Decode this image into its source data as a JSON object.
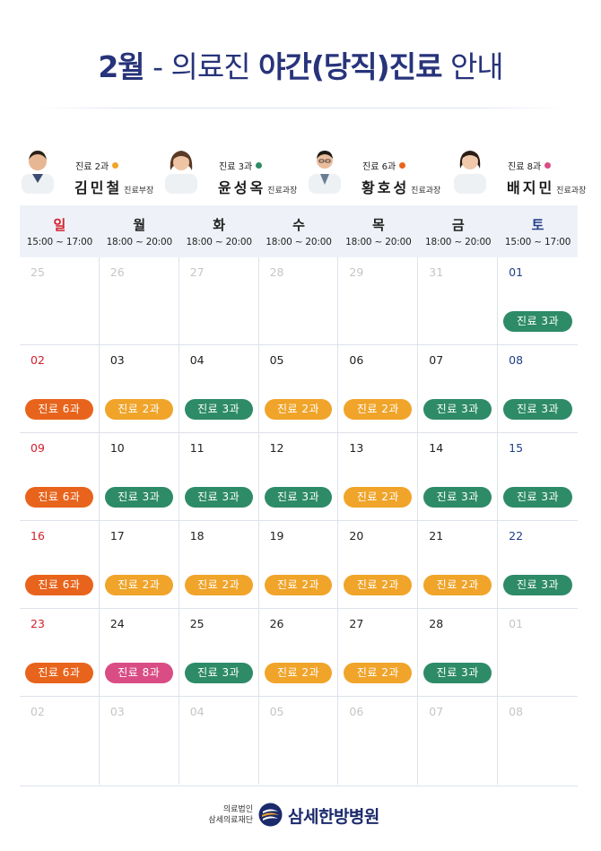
{
  "title": {
    "month": "2월",
    "dash": " - ",
    "prefix": "의료진 ",
    "highlight": "야간(당직)진료",
    "suffix": " 안내"
  },
  "doctors": [
    {
      "dept": "진료 2과",
      "name": "김민철",
      "role": "진료부장",
      "color": "#f0a42a"
    },
    {
      "dept": "진료 3과",
      "name": "윤성옥",
      "role": "진료과장",
      "color": "#2e8b68"
    },
    {
      "dept": "진료 6과",
      "name": "황호성",
      "role": "진료과장",
      "color": "#e8641c"
    },
    {
      "dept": "진료 8과",
      "name": "배지민",
      "role": "진료과장",
      "color": "#d94d84"
    }
  ],
  "weekdays": [
    {
      "day": "일",
      "time": "15:00 ~ 17:00"
    },
    {
      "day": "월",
      "time": "18:00 ~ 20:00"
    },
    {
      "day": "화",
      "time": "18:00 ~ 20:00"
    },
    {
      "day": "수",
      "time": "18:00 ~ 20:00"
    },
    {
      "day": "목",
      "time": "18:00 ~ 20:00"
    },
    {
      "day": "금",
      "time": "18:00 ~ 20:00"
    },
    {
      "day": "토",
      "time": "15:00 ~ 17:00"
    }
  ],
  "dept_colors": {
    "진료 2과": "#f0a42a",
    "진료 3과": "#2e8b68",
    "진료 6과": "#e8641c",
    "진료 8과": "#d94d84"
  },
  "weeks": [
    [
      {
        "date": "25",
        "dim": true
      },
      {
        "date": "26",
        "dim": true
      },
      {
        "date": "27",
        "dim": true
      },
      {
        "date": "28",
        "dim": true
      },
      {
        "date": "29",
        "dim": true
      },
      {
        "date": "31",
        "dim": true
      },
      {
        "date": "01",
        "duty": "진료 3과"
      }
    ],
    [
      {
        "date": "02",
        "duty": "진료 6과"
      },
      {
        "date": "03",
        "duty": "진료 2과"
      },
      {
        "date": "04",
        "duty": "진료 3과"
      },
      {
        "date": "05",
        "duty": "진료 2과"
      },
      {
        "date": "06",
        "duty": "진료 2과"
      },
      {
        "date": "07",
        "duty": "진료 3과"
      },
      {
        "date": "08",
        "duty": "진료 3과"
      }
    ],
    [
      {
        "date": "09",
        "duty": "진료 6과"
      },
      {
        "date": "10",
        "duty": "진료 3과"
      },
      {
        "date": "11",
        "duty": "진료 3과"
      },
      {
        "date": "12",
        "duty": "진료 3과"
      },
      {
        "date": "13",
        "duty": "진료 2과"
      },
      {
        "date": "14",
        "duty": "진료 3과"
      },
      {
        "date": "15",
        "duty": "진료 3과"
      }
    ],
    [
      {
        "date": "16",
        "duty": "진료 6과"
      },
      {
        "date": "17",
        "duty": "진료 2과"
      },
      {
        "date": "18",
        "duty": "진료 2과"
      },
      {
        "date": "19",
        "duty": "진료 2과"
      },
      {
        "date": "20",
        "duty": "진료 2과"
      },
      {
        "date": "21",
        "duty": "진료 2과"
      },
      {
        "date": "22",
        "duty": "진료 3과"
      }
    ],
    [
      {
        "date": "23",
        "duty": "진료 6과"
      },
      {
        "date": "24",
        "duty": "진료 8과"
      },
      {
        "date": "25",
        "duty": "진료 3과"
      },
      {
        "date": "26",
        "duty": "진료 2과"
      },
      {
        "date": "27",
        "duty": "진료 2과"
      },
      {
        "date": "28",
        "duty": "진료 3과"
      },
      {
        "date": "01",
        "dim": true
      }
    ],
    [
      {
        "date": "02",
        "dim": true
      },
      {
        "date": "03",
        "dim": true
      },
      {
        "date": "04",
        "dim": true
      },
      {
        "date": "05",
        "dim": true
      },
      {
        "date": "06",
        "dim": true
      },
      {
        "date": "07",
        "dim": true
      },
      {
        "date": "08",
        "dim": true
      }
    ]
  ],
  "footer": {
    "line1": "의료법인",
    "line2": "삼세의료재단",
    "name": "삼세한방병원"
  }
}
